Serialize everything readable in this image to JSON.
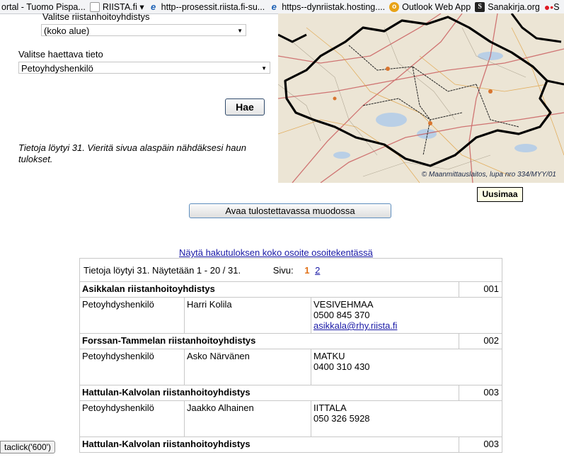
{
  "bookmarks": [
    {
      "icon": "ie-icon",
      "label": "ortal - Tuomo Pispa..."
    },
    {
      "icon": "riista-icon",
      "label": "RIISTA.fi ▾"
    },
    {
      "icon": "ie-icon",
      "label": "http--prosessit.riista.fi-su..."
    },
    {
      "icon": "ie-icon",
      "label": "https--dynriistak.hosting...."
    },
    {
      "icon": "outlook-icon",
      "label": "Outlook Web App"
    },
    {
      "icon": "sanakirja-icon",
      "label": "Sanakirja.org"
    },
    {
      "icon": "red-dots-icon",
      "label": "S"
    }
  ],
  "form": {
    "rhy_label": "Valitse riistanhoitoyhdistys",
    "rhy_value": "(koko alue)",
    "field_label": "Valitse haettava tieto",
    "field_value": "Petoyhdyshenkilö",
    "search_button": "Hae",
    "found_note": "Tietoja löytyi 31. Vieritä sivua alaspäin nähdäksesi haun tulokset."
  },
  "map": {
    "copyright": "© Maanmittauslaitos, lupa nro 334/MYY/01",
    "region_label": "Uusimaa"
  },
  "print_button": "Avaa tulostettavassa muodossa",
  "address_link": "Näytä hakutuloksen koko osoite osoitekentässä",
  "results": {
    "summary": "Tietoja löytyi 31. Näytetään 1 - 20 / 31.",
    "page_label": "Sivu:",
    "current_page": "1",
    "next_page": "2",
    "items": [
      {
        "name": "Asikkalan riistanhoitoyhdistys",
        "code": "001",
        "role": "Petoyhdyshenkilö",
        "person": "Harri Kolila",
        "place": "VESIVEHMAA",
        "phone": "0500 845 370",
        "email": "asikkala@rhy.riista.fi"
      },
      {
        "name": "Forssan-Tammelan riistanhoitoyhdistys",
        "code": "002",
        "role": "Petoyhdyshenkilö",
        "person": "Asko Närvänen",
        "place": "MATKU",
        "phone": "0400 310 430",
        "email": ""
      },
      {
        "name": "Hattulan-Kalvolan riistanhoitoyhdistys",
        "code": "003",
        "role": "Petoyhdyshenkilö",
        "person": "Jaakko Alhainen",
        "place": "IITTALA",
        "phone": "050 326 5928",
        "email": ""
      },
      {
        "name": "Hattulan-Kalvolan riistanhoitoyhdistys",
        "code": "003"
      }
    ]
  },
  "status_text": "taclick('600')"
}
